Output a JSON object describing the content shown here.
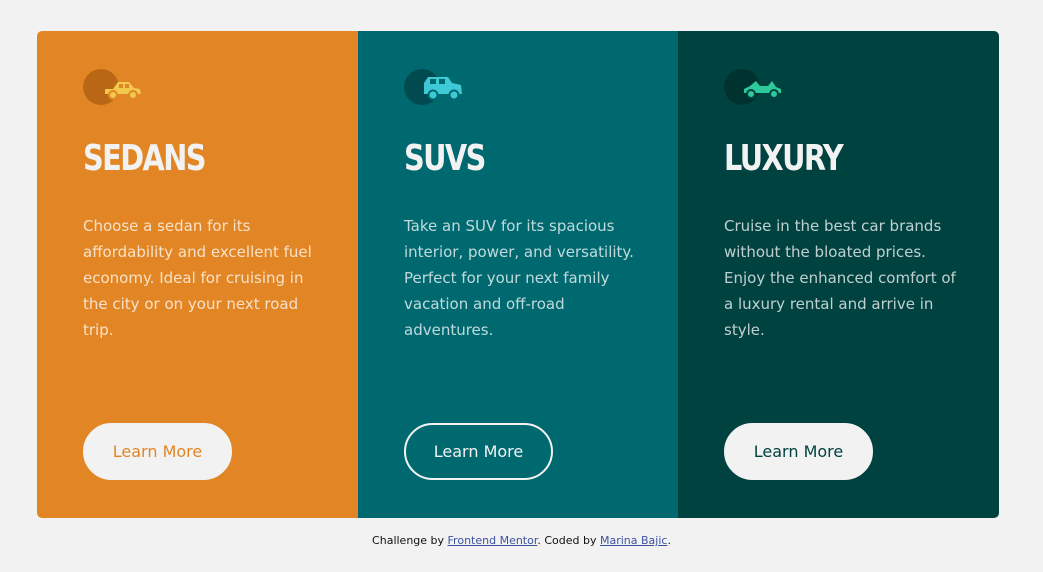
{
  "cards": [
    {
      "title": "SEDANS",
      "description": "Choose a sedan for its affordability and excellent fuel economy. Ideal for cruising in the city or on your next road trip.",
      "button_label": "Learn More",
      "icon": "sedan-icon",
      "bg_color": "#e28625"
    },
    {
      "title": "SUVS",
      "description": "Take an SUV for its spacious interior, power, and versatility. Perfect for your next family vacation and off-road adventures.",
      "button_label": "Learn More",
      "icon": "suv-icon",
      "bg_color": "#006970"
    },
    {
      "title": "LUXURY",
      "description": "Cruise in the best car brands without the bloated prices. Enjoy the enhanced comfort of a luxury rental and arrive in style.",
      "button_label": "Learn More",
      "icon": "luxury-car-icon",
      "bg_color": "#004240"
    }
  ],
  "attribution": {
    "prefix": "Challenge by ",
    "link1": "Frontend Mentor",
    "middle": ". Coded by ",
    "link2": "Marina Bajic",
    "suffix": "."
  },
  "colors": {
    "page_bg": "#f2f2f2",
    "light_text": "#f2f2f2"
  }
}
